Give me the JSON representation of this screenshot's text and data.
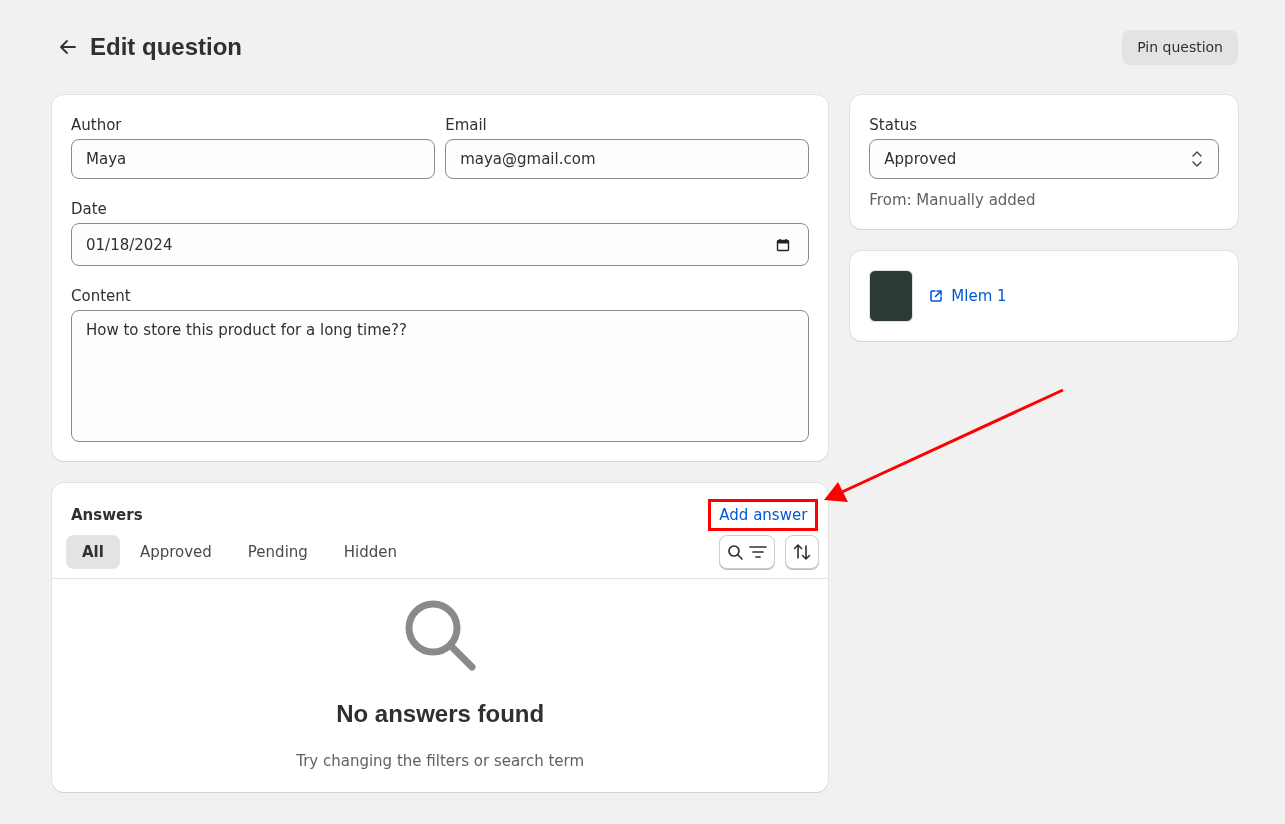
{
  "page": {
    "title": "Edit question",
    "pin_button": "Pin question"
  },
  "question": {
    "fields": [
      {
        "label": "Author",
        "value": "Maya",
        "kind": "text"
      },
      {
        "label": "Email",
        "value": "maya@gmail.com",
        "kind": "text"
      },
      {
        "label": "Date",
        "value": "01/18/2024",
        "kind": "date"
      },
      {
        "label": "Content",
        "value": "How to store this product for a long time??",
        "kind": "textarea"
      }
    ]
  },
  "answers": {
    "title": "Answers",
    "add_button": "Add answer",
    "highlighted": true,
    "tabs": [
      {
        "label": "All",
        "selected": true
      },
      {
        "label": "Approved",
        "selected": false
      },
      {
        "label": "Pending",
        "selected": false
      },
      {
        "label": "Hidden",
        "selected": false
      }
    ],
    "empty": {
      "title": "No answers found",
      "hint": "Try changing the filters or search term"
    }
  },
  "status": {
    "label": "Status",
    "value": "Approved",
    "source": "From: Manually added"
  },
  "product": {
    "name": "Mlem 1"
  }
}
